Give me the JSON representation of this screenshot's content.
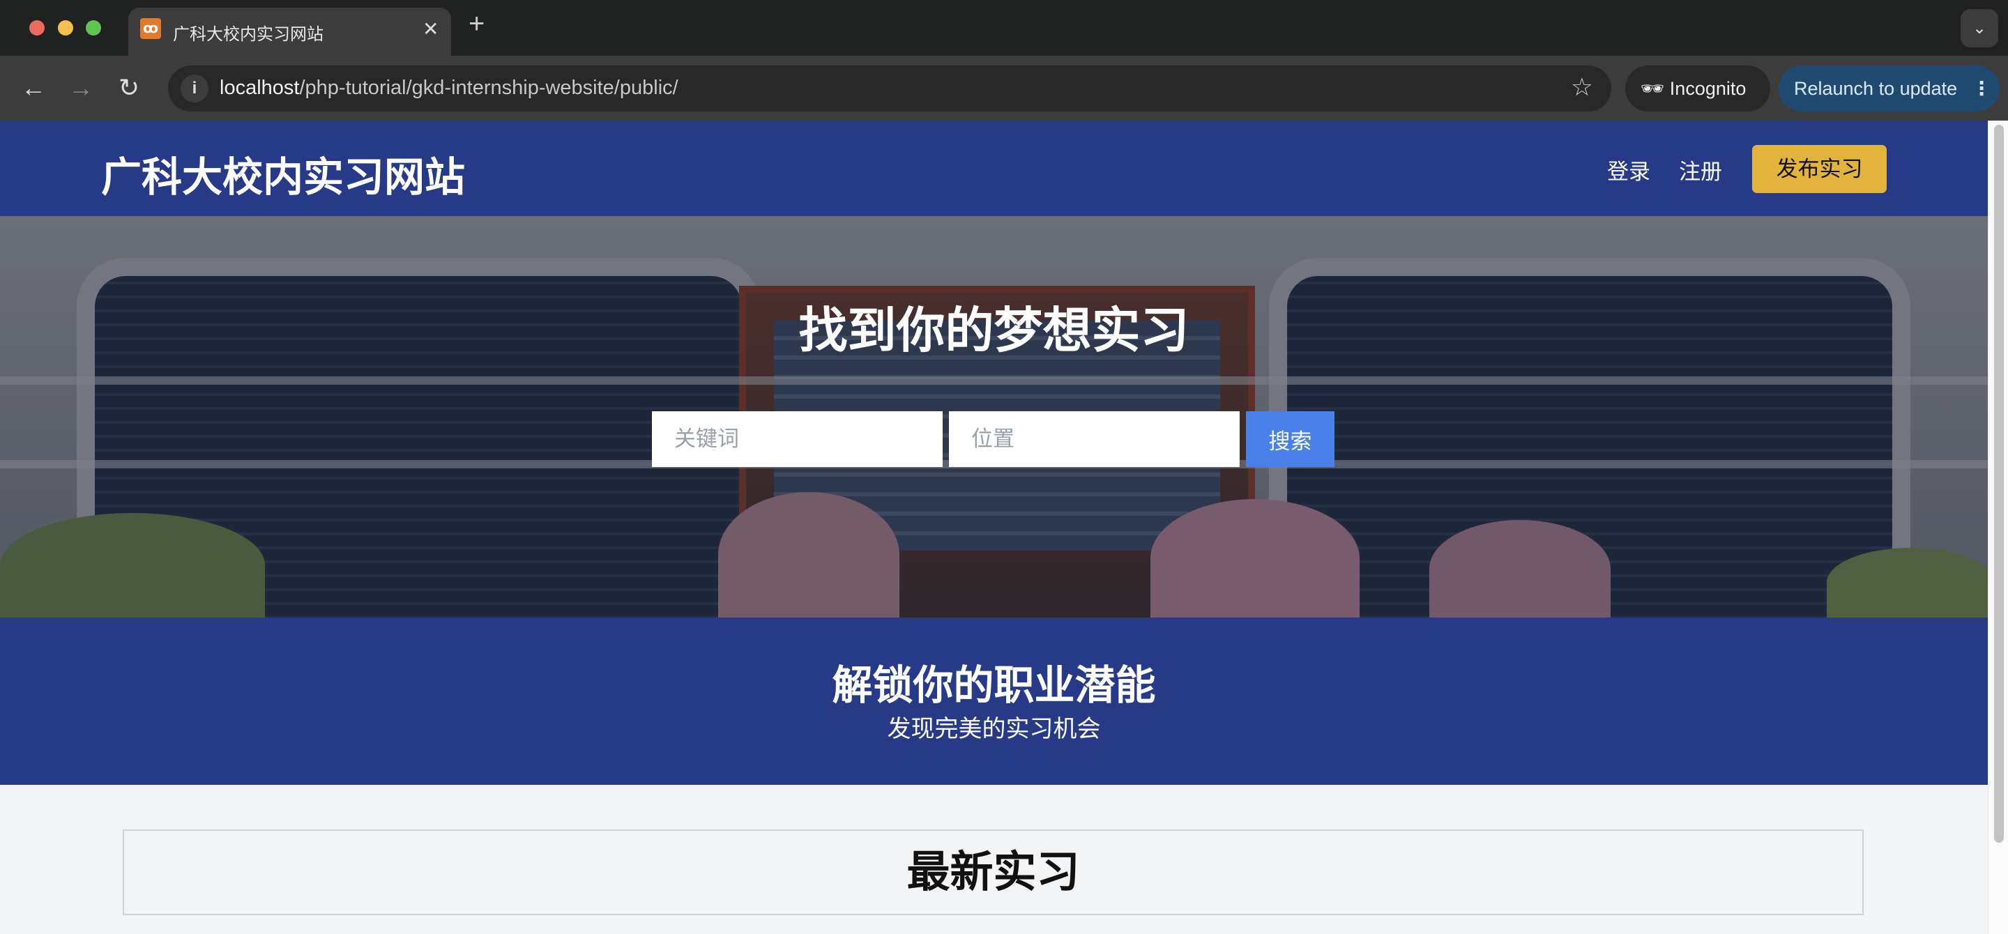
{
  "browser": {
    "tab_title": "广科大校内实习网站",
    "favicon": "xampp-icon",
    "url_host": "localhost",
    "url_path": "/php-tutorial/gkd-internship-website/public/",
    "incognito_label": "Incognito",
    "relaunch_label": "Relaunch to update"
  },
  "header": {
    "site_title": "广科大校内实习网站",
    "login": "登录",
    "register": "注册",
    "post_internship": "发布实习",
    "colors": {
      "nav_bg": "#263a87",
      "post_button": "#e2b43c"
    }
  },
  "hero": {
    "title": "找到你的梦想实习",
    "keyword_placeholder": "关键词",
    "location_placeholder": "位置",
    "search_label": "搜索",
    "search_color": "#4a80ea"
  },
  "promo": {
    "title": "解锁你的职业潜能",
    "subtitle": "发现完美的实习机会"
  },
  "latest": {
    "title": "最新实习"
  }
}
